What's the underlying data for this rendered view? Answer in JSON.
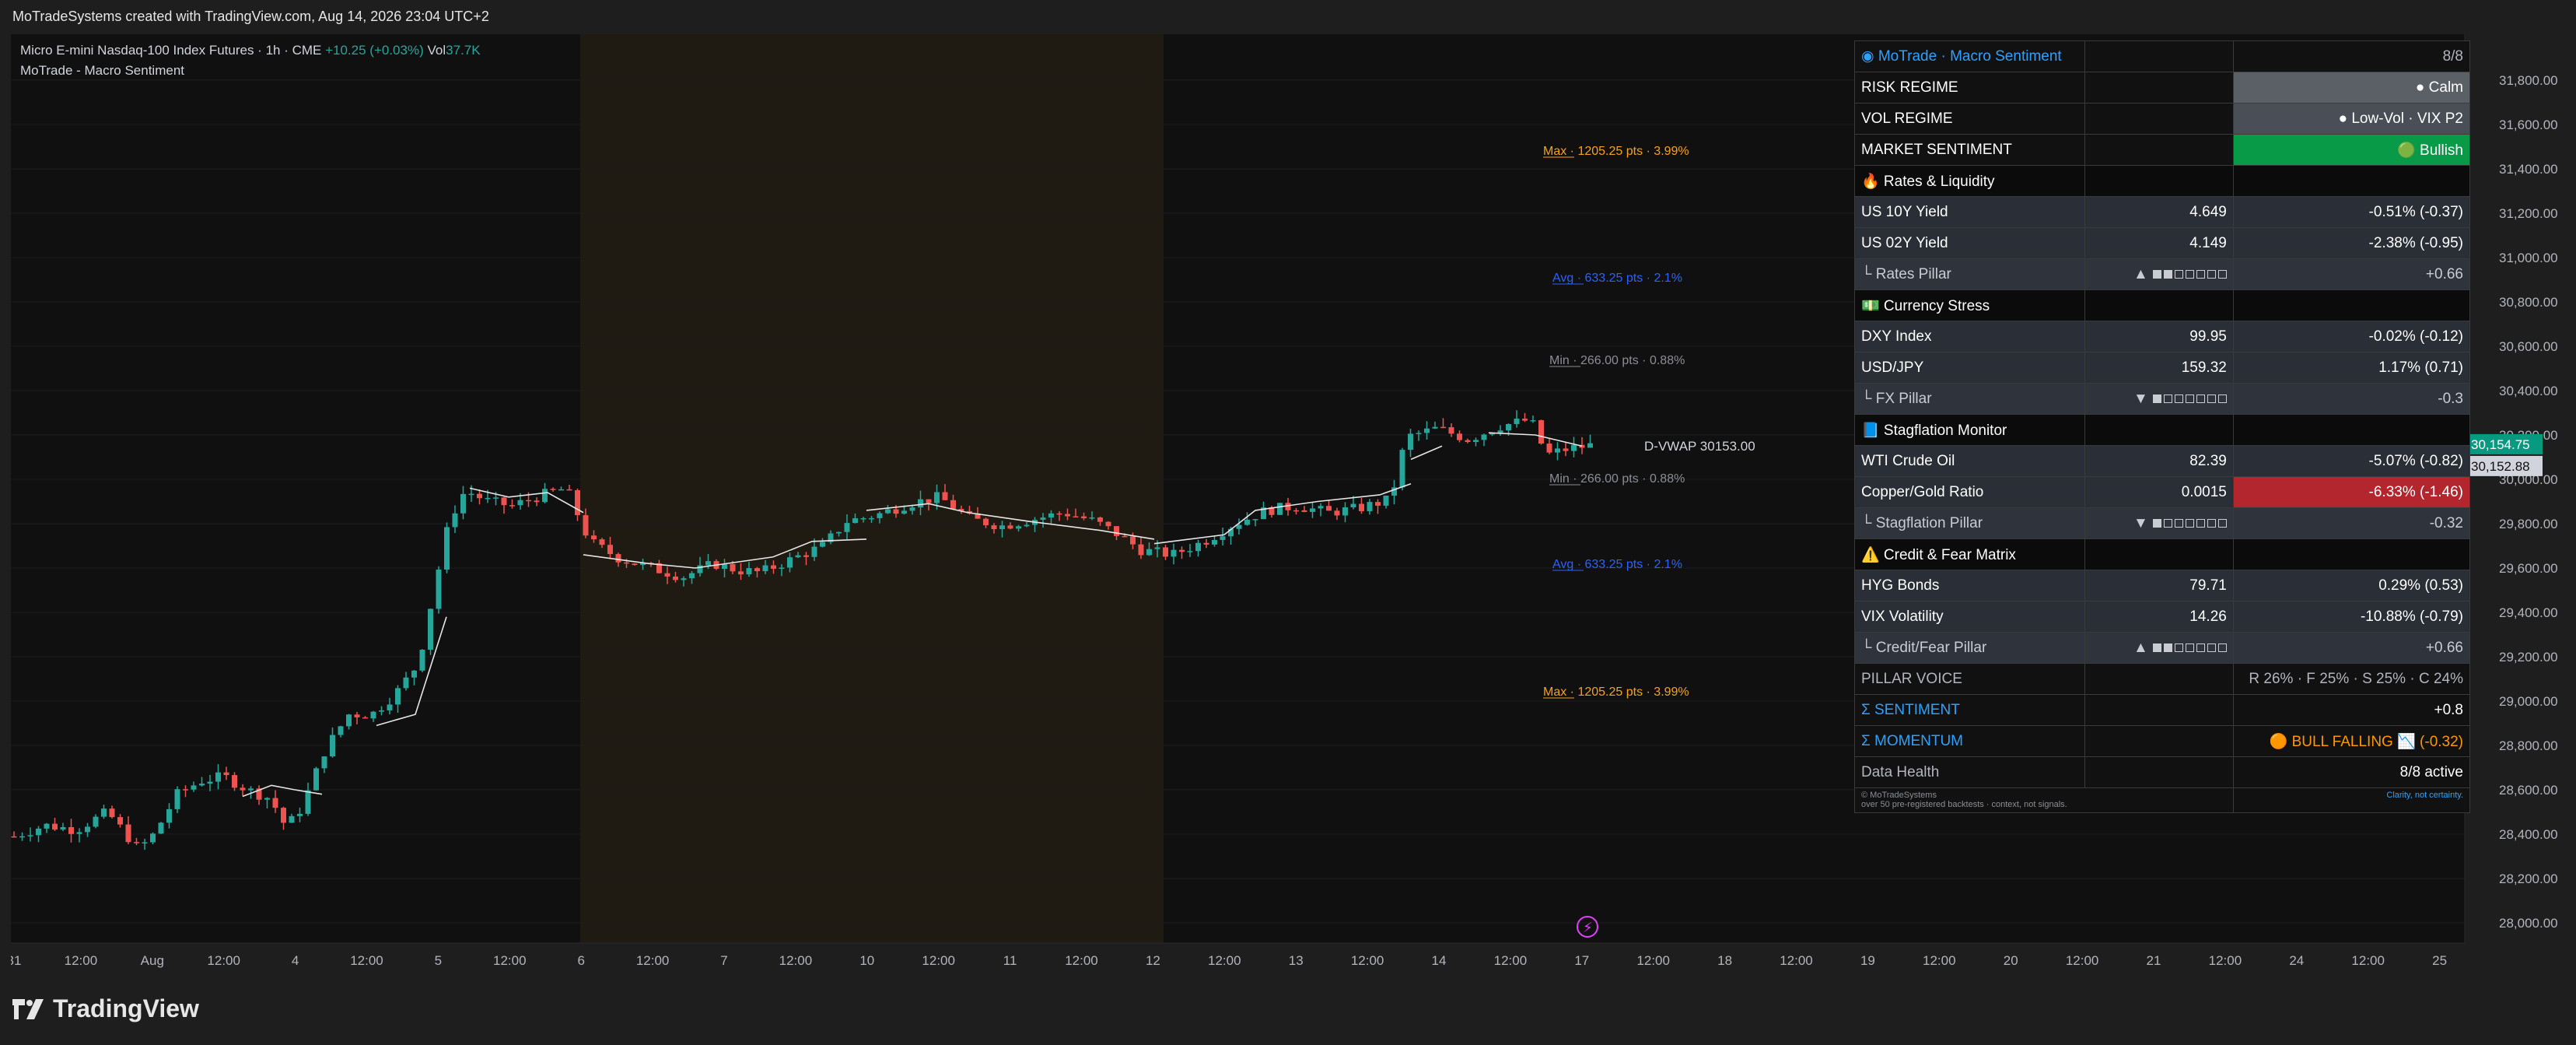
{
  "topbar": {
    "text": "MoTradeSystems created with TradingView.com, Aug 14, 2026 23:04 UTC+2"
  },
  "legend": {
    "symbol": "Micro E-mini Nasdaq-100 Index Futures · 1h · CME",
    "change": "+10.25 (+0.03%)",
    "vol_label": "Vol",
    "vol_value": "37.7K",
    "indicator": "MoTrade - Macro Sentiment"
  },
  "price_axis": {
    "ticks": [
      "31,800.00",
      "31,600.00",
      "31,400.00",
      "31,200.00",
      "31,000.00",
      "30,800.00",
      "30,600.00",
      "30,400.00",
      "30,200.00",
      "30,000.00",
      "29,800.00",
      "29,600.00",
      "29,400.00",
      "29,200.00",
      "29,000.00",
      "28,800.00",
      "28,600.00",
      "28,400.00",
      "28,200.00",
      "28,000.00"
    ],
    "last_price": "30,154.75",
    "vwap_price": "30,152.88"
  },
  "time_axis": {
    "ticks": [
      "31",
      "12:00",
      "Aug",
      "12:00",
      "4",
      "12:00",
      "5",
      "12:00",
      "6",
      "12:00",
      "7",
      "12:00",
      "10",
      "12:00",
      "11",
      "12:00",
      "12",
      "12:00",
      "13",
      "12:00",
      "14",
      "12:00",
      "17",
      "12:00",
      "18",
      "12:00",
      "19",
      "12:00",
      "20",
      "12:00",
      "21",
      "12:00",
      "24",
      "12:00",
      "25"
    ]
  },
  "annotations": {
    "max_top": "Max · 1205.25 pts · 3.99%",
    "avg_top": "Avg · 633.25 pts · 2.1%",
    "min_top": "Min · 266.00 pts · 0.88%",
    "vwap": "D-VWAP 30153.00",
    "min_bottom": "Min · 266.00 pts · 0.88%",
    "avg_bottom": "Avg · 633.25 pts · 2.1%",
    "max_bottom": "Max · 1205.25 pts · 3.99%"
  },
  "colors": {
    "up": "#26a69a",
    "down": "#ef5350",
    "accent": "#2ea1ff",
    "bull": "#089a47",
    "max": "#f7a21b",
    "avg": "#2962ff"
  },
  "table": {
    "title": "◉ MoTrade · Macro Sentiment",
    "count": "8/8",
    "risk_regime_label": "RISK REGIME",
    "risk_regime_value": "● Calm",
    "vol_regime_label": "VOL REGIME",
    "vol_regime_value": "● Low-Vol · VIX P2",
    "market_sentiment_label": "MARKET SENTIMENT",
    "market_sentiment_value": "🟢 Bullish",
    "sec_rates": "🔥 Rates & Liquidity",
    "us10_label": "US 10Y Yield",
    "us10_value": "4.649",
    "us10_change": "-0.51% (-0.37)",
    "us02_label": "US 02Y Yield",
    "us02_value": "4.149",
    "us02_change": "-2.38% (-0.95)",
    "rates_pillar_label": "└ Rates Pillar",
    "rates_pillar_arrow": "▲",
    "rates_pillar_score": "+0.66",
    "rates_pillar_fill": 2,
    "sec_currency": "💵 Currency Stress",
    "dxy_label": "DXY Index",
    "dxy_value": "99.95",
    "dxy_change": "-0.02% (-0.12)",
    "usdjpy_label": "USD/JPY",
    "usdjpy_value": "159.32",
    "usdjpy_change": "1.17% (0.71)",
    "fx_pillar_label": "└ FX Pillar",
    "fx_pillar_arrow": "▼",
    "fx_pillar_score": "-0.3",
    "fx_pillar_fill": 1,
    "sec_stagflation": "📘 Stagflation Monitor",
    "wti_label": "WTI Crude Oil",
    "wti_value": "82.39",
    "wti_change": "-5.07% (-0.82)",
    "cg_label": "Copper/Gold Ratio",
    "cg_value": "0.0015",
    "cg_change": "-6.33% (-1.46)",
    "stag_pillar_label": "└ Stagflation Pillar",
    "stag_pillar_arrow": "▼",
    "stag_pillar_score": "-0.32",
    "stag_pillar_fill": 1,
    "sec_credit": "⚠️ Credit & Fear Matrix",
    "hyg_label": "HYG Bonds",
    "hyg_value": "79.71",
    "hyg_change": "0.29% (0.53)",
    "vix_label": "VIX Volatility",
    "vix_value": "14.26",
    "vix_change": "-10.88% (-0.79)",
    "credit_pillar_label": "└ Credit/Fear Pillar",
    "credit_pillar_arrow": "▲",
    "credit_pillar_score": "+0.66",
    "credit_pillar_fill": 2,
    "pillar_voice_label": "PILLAR VOICE",
    "pillar_voice_value": "R 26% · F 25% · S 25% · C 24%",
    "sentiment_label": "Σ SENTIMENT",
    "sentiment_value": "+0.8",
    "momentum_label": "Σ MOMENTUM",
    "momentum_value": "🟠 BULL FALLING 📉 (-0.32)",
    "data_health_label": "Data Health",
    "data_health_value": "8/8 active",
    "footnote_left_1": "© MoTradeSystems",
    "footnote_left_2": "over 50 pre-registered backtests · context, not signals.",
    "footnote_right": "Clarity, not certainty."
  },
  "footer": {
    "logo": "TradingView"
  }
}
